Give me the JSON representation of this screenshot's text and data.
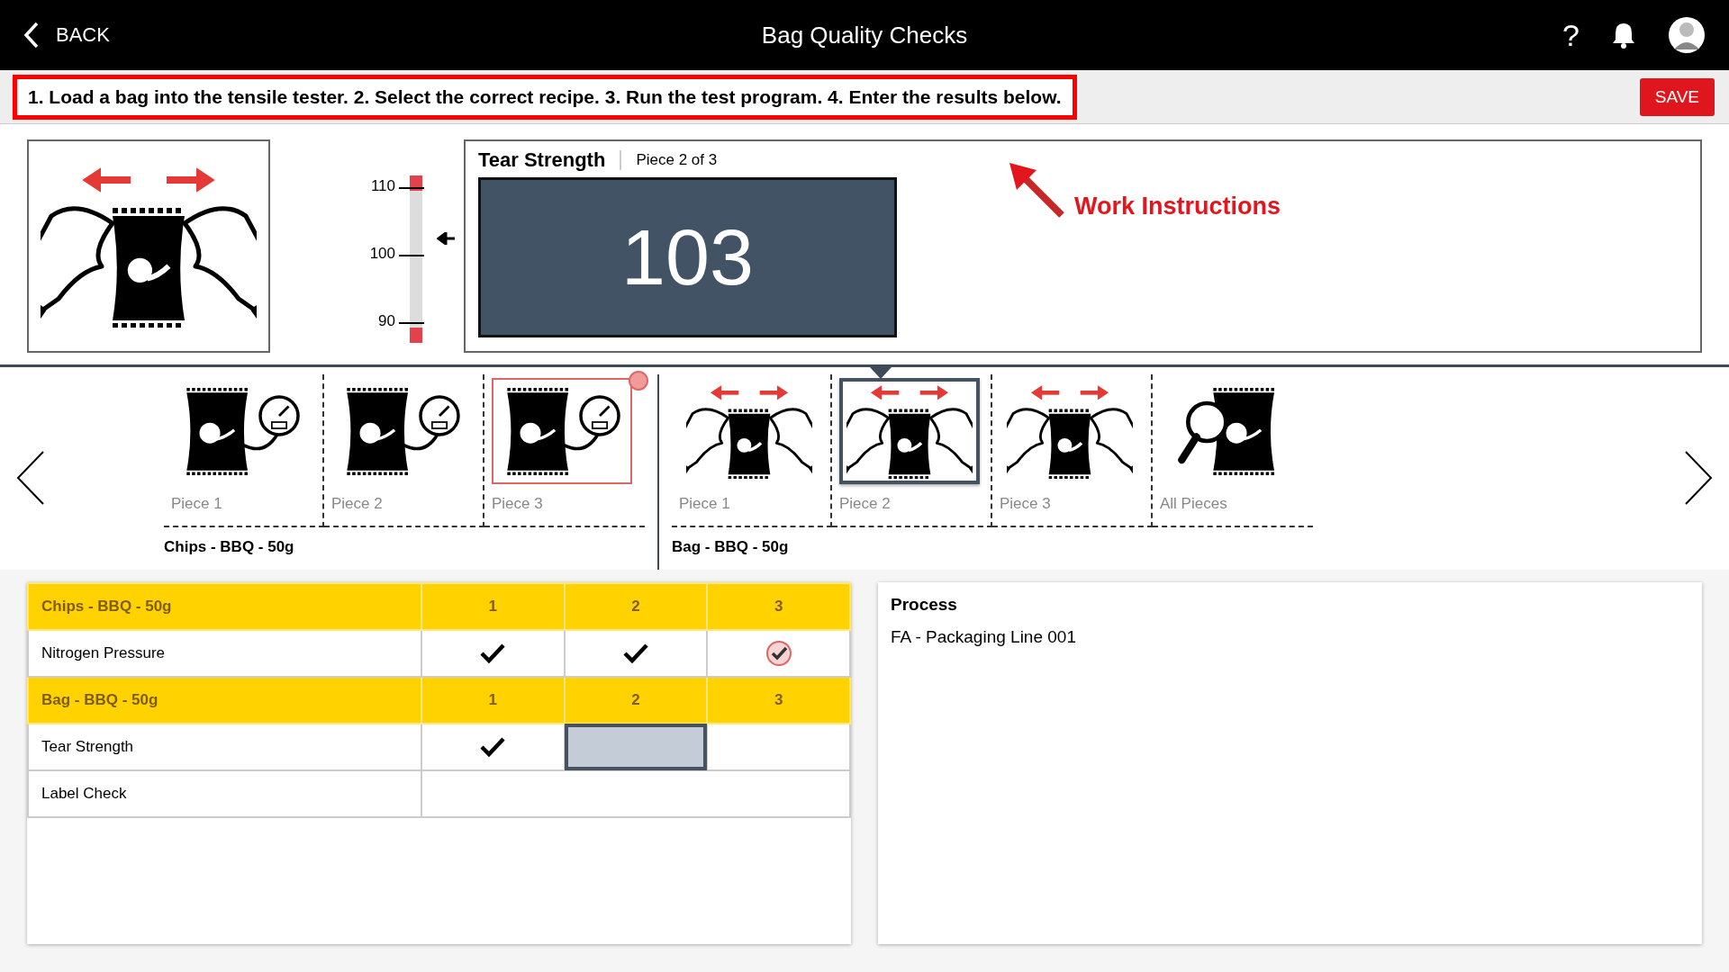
{
  "header": {
    "back_label": "BACK",
    "title": "Bag Quality Checks",
    "help": "?"
  },
  "instruction_bar": {
    "text": "1. Load a bag into the tensile tester. 2. Select the correct recipe. 3. Run the test program. 4. Enter the results below.",
    "save_label": "SAVE"
  },
  "gauge": {
    "ticks": [
      "110",
      "100",
      "90"
    ],
    "level": 0.625
  },
  "reading": {
    "title": "Tear Strength",
    "subtitle": "Piece 2 of 3",
    "value": "103",
    "annotation": "Work Instructions"
  },
  "carousel": {
    "groups": [
      {
        "label": "Chips - BBQ - 50g",
        "items": [
          {
            "label": "Piece 1",
            "kind": "pressure",
            "selected": false,
            "flagged": false
          },
          {
            "label": "Piece 2",
            "kind": "pressure",
            "selected": false,
            "flagged": false
          },
          {
            "label": "Piece 3",
            "kind": "pressure",
            "selected": false,
            "flagged": true
          }
        ]
      },
      {
        "label": "Bag - BBQ - 50g",
        "items": [
          {
            "label": "Piece 1",
            "kind": "tear",
            "selected": false,
            "flagged": false
          },
          {
            "label": "Piece 2",
            "kind": "tear",
            "selected": true,
            "flagged": false
          },
          {
            "label": "Piece 3",
            "kind": "tear",
            "selected": false,
            "flagged": false
          },
          {
            "label": "All Pieces",
            "kind": "inspect",
            "selected": false,
            "flagged": false
          }
        ]
      }
    ]
  },
  "table": {
    "sections": [
      {
        "name": "Chips - BBQ - 50g",
        "columns": [
          "1",
          "2",
          "3"
        ],
        "rows": [
          {
            "name": "Nitrogen Pressure",
            "cells": [
              {
                "checked": true,
                "flagged": false,
                "active": false
              },
              {
                "checked": true,
                "flagged": false,
                "active": false
              },
              {
                "checked": true,
                "flagged": true,
                "active": false
              }
            ]
          }
        ]
      },
      {
        "name": "Bag - BBQ - 50g",
        "columns": [
          "1",
          "2",
          "3"
        ],
        "rows": [
          {
            "name": "Tear Strength",
            "cells": [
              {
                "checked": true,
                "flagged": false,
                "active": false
              },
              {
                "checked": false,
                "flagged": false,
                "active": true
              },
              {
                "checked": false,
                "flagged": false,
                "active": false
              }
            ]
          },
          {
            "name": "Label Check"
          }
        ]
      }
    ]
  },
  "process": {
    "title": "Process",
    "value": "FA - Packaging Line 001"
  }
}
